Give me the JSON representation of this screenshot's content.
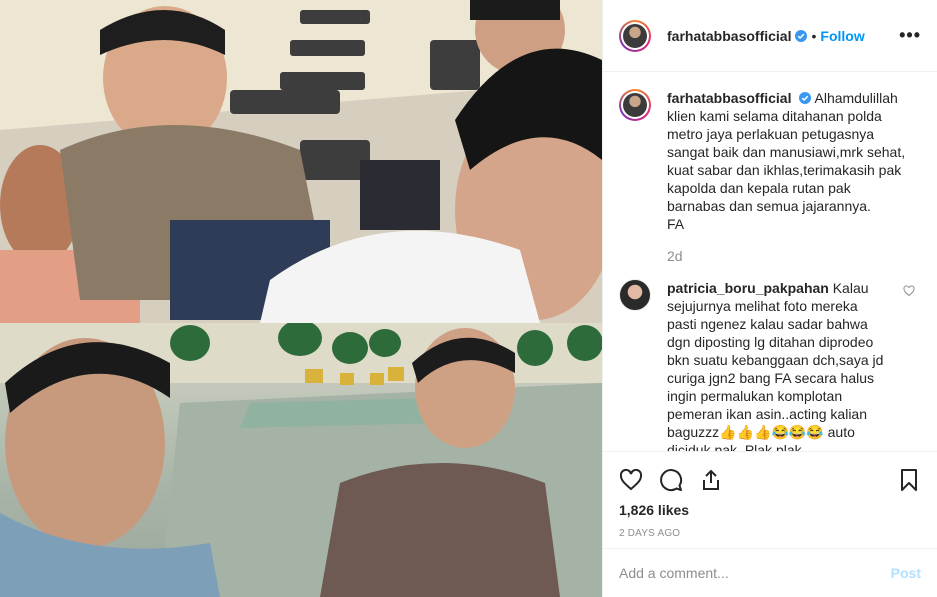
{
  "post": {
    "username": "farhatabbasofficial",
    "separator": "•",
    "follow_label": "Follow",
    "more_label": "•••",
    "caption": "Alhamdulillah klien kami selama ditahanan polda metro jaya perlakuan petugasnya sangat baik dan manusiawi,mrk sehat, kuat sabar dan ikhlas,terimakasih pak kapolda dan kepala rutan pak barnabas dan semua jajarannya.",
    "signature": "FA",
    "caption_time": "2d",
    "likes": "1,826 likes",
    "date": "2 DAYS AGO"
  },
  "comments": [
    {
      "username": "patricia_boru_pakpahan",
      "text": "Kalau sejujurnya melihat foto mereka pasti ngenez kalau sadar bahwa dgn diposting lg ditahan diprodeo bkn suatu kebanggaan dch,saya jd curiga jgn2 bang FA secara halus ingin permalukan komplotan pemeran ikan asin..acting kalian baguzzz👍👍👍😂😂😂 auto diciduk pak. Plak plak"
    }
  ],
  "add_comment": {
    "placeholder": "Add a comment...",
    "post_label": "Post"
  },
  "icons": {
    "like": "heart-icon",
    "comment": "comment-icon",
    "share": "share-icon",
    "save": "bookmark-icon",
    "verified": "verified-badge-icon"
  },
  "colors": {
    "link_blue": "#0095f6",
    "post_disabled": "#b2dffc",
    "muted": "#8e8e8e",
    "border": "#efefef"
  }
}
